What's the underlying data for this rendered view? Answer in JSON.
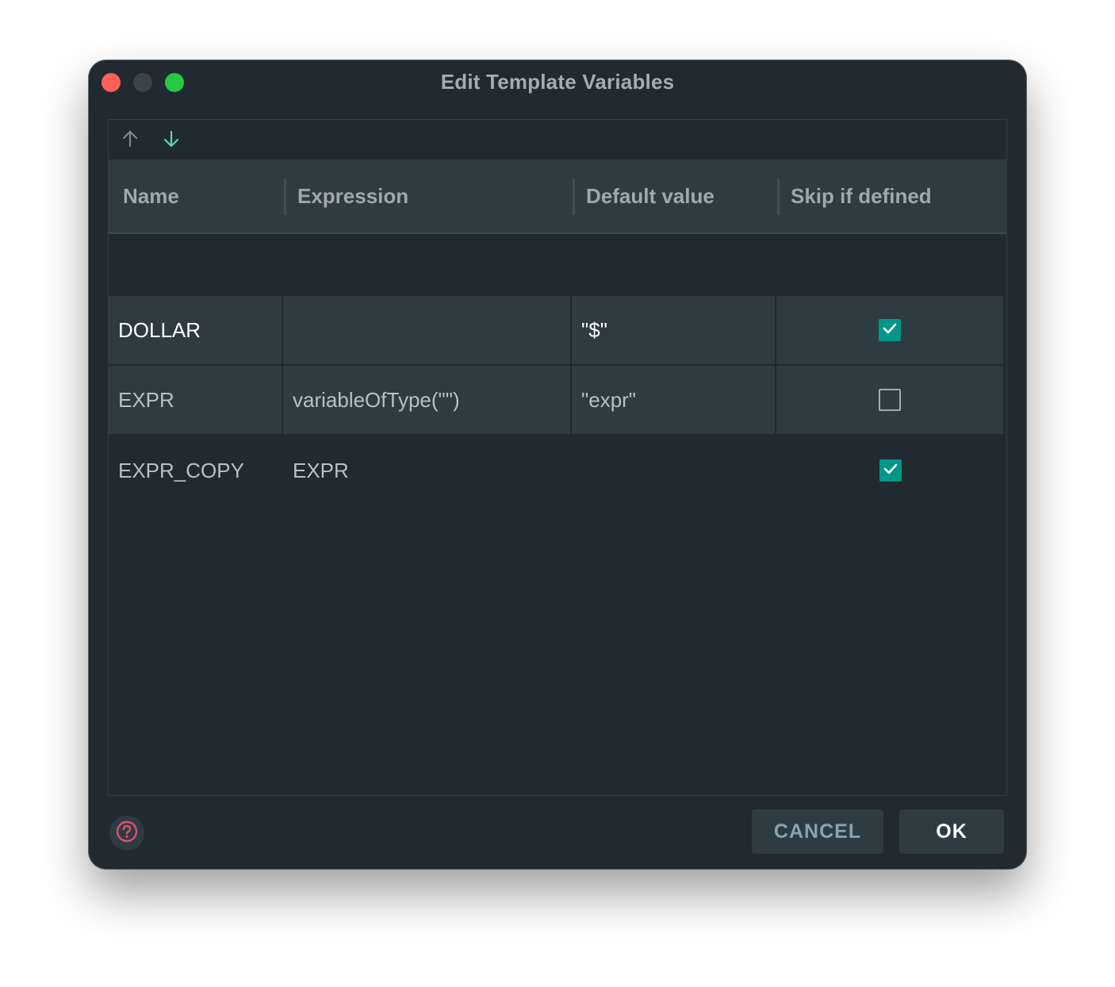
{
  "window": {
    "title": "Edit Template Variables"
  },
  "toolbar": {
    "move_up_icon": "arrow-up-icon",
    "move_down_icon": "arrow-down-icon"
  },
  "table": {
    "columns": [
      "Name",
      "Expression",
      "Default value",
      "Skip if defined"
    ],
    "rows": [
      {
        "name": "DOLLAR",
        "expression": "",
        "default_value": "\"$\"",
        "skip_if_defined": true
      },
      {
        "name": "EXPR",
        "expression": "variableOfType(\"\")",
        "default_value": "\"expr\"",
        "skip_if_defined": false
      },
      {
        "name": "EXPR_COPY",
        "expression": "EXPR",
        "default_value": "",
        "skip_if_defined": true
      }
    ]
  },
  "footer": {
    "help_icon": "help-icon",
    "cancel_label": "CANCEL",
    "ok_label": "OK"
  },
  "colors": {
    "background": "#212a30",
    "header": "#2e3b43",
    "accent": "#009688",
    "help_icon": "#e0506e",
    "close": "#fe5f57",
    "maximize": "#28c840"
  }
}
